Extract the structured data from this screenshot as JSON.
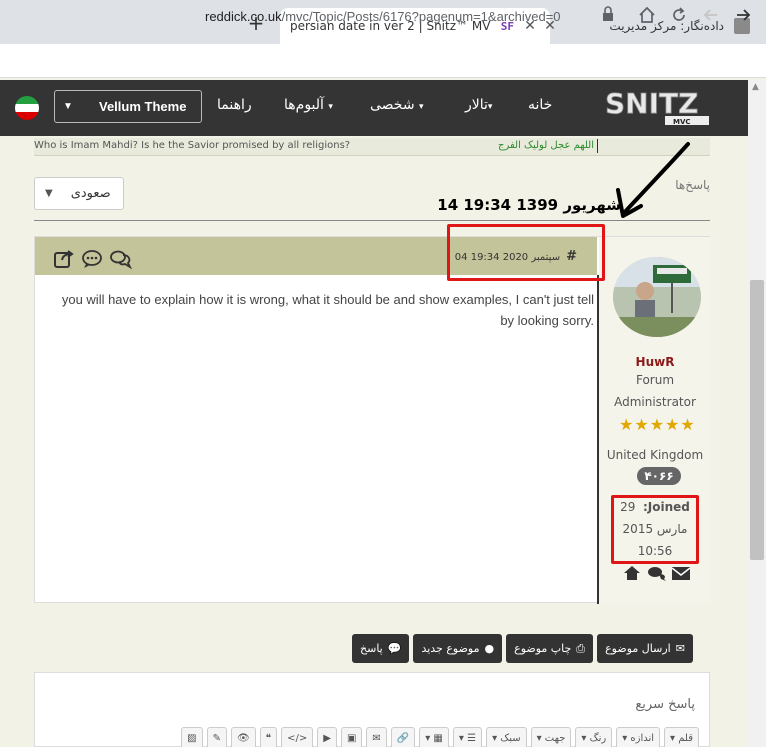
{
  "browser": {
    "active_tab_title": "persian date in ver 2 | Snitz™ MV",
    "active_tab_favicon": "SF",
    "inactive_tab_title": "داده‌نگار: مرکز مدیریت",
    "new_tab": "+",
    "close": "✕",
    "url_host": "reddick.co.uk",
    "url_path": "/mvc/Topic/Posts/6176?pagenum=1&archived=0"
  },
  "forum_nav": {
    "theme_label": "Vellum Theme",
    "items": [
      "خانه",
      "تالار",
      "شخصی",
      "آلبوم‌ها",
      "راهنما"
    ],
    "logo_text": "SNITZ",
    "logo_sub": "MVC"
  },
  "ticker": {
    "english": "Who is Imam Mahdi? Is he the Savior promised by all religions?",
    "arabic": "اللهم عجل لولیک الفرج"
  },
  "topic": {
    "replies_label": "پاسخ‌ها",
    "sort_label": "صعودی",
    "date_heading": "14 شهریور 1399 19:34"
  },
  "post": {
    "date": "04 سپتمبر 2020 19:34",
    "hash": "#",
    "body": "you will have to explain how it is wrong, what it should be and show examples, I can't just tell by looking sorry.",
    "author": {
      "name": "HuwR",
      "role_line1": "Forum",
      "role_line2": "Administrator",
      "stars": 5,
      "country": "United Kingdom",
      "post_count": "۴۰۶۶",
      "joined_label": ":Joined",
      "joined_day": "29",
      "joined_month_year": "مارس 2015",
      "joined_time": "10:56"
    }
  },
  "buttons": [
    {
      "label": "ارسال موضوع",
      "icon": "envelope-icon"
    },
    {
      "label": "چاپ موضوع",
      "icon": "print-icon"
    },
    {
      "label": "موضوع جدید",
      "icon": "comment-icon"
    },
    {
      "label": "پاسخ",
      "icon": "comments-icon"
    }
  ],
  "quick_reply": {
    "title": "پاسخ سریع",
    "toolbar": [
      "قلم ▾",
      "اندازه ▾",
      "رنگ ▾",
      "جهت ▾",
      "سبک ▾",
      "☰ ▾",
      "▦ ▾",
      "🔗",
      "✉",
      "▣",
      "▶",
      "</>",
      "❝",
      "👁",
      "✎",
      "▨"
    ]
  },
  "colors": {
    "annotation_red": "#e01515",
    "header_band": "#c4c49a",
    "nav_bg": "#343434"
  }
}
